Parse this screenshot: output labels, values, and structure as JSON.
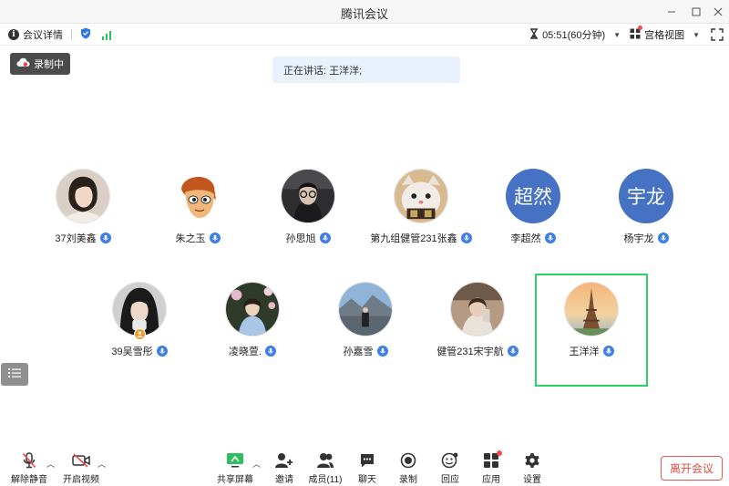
{
  "window": {
    "title": "腾讯会议"
  },
  "infobar": {
    "meeting_details": "会议详情",
    "timer": "05:51(60分钟)",
    "view_mode": "宫格视图"
  },
  "recording_badge": "录制中",
  "speaking_label": "正在讲话: 王洋洋;",
  "participants": [
    {
      "name": "37刘美鑫",
      "avatar": "photo-woman"
    },
    {
      "name": "朱之玉",
      "avatar": "cartoon-boy"
    },
    {
      "name": "孙思旭",
      "avatar": "photo-man-glasses"
    },
    {
      "name": "第九组健管231张鑫",
      "avatar": "photo-cat"
    },
    {
      "name": "李超然",
      "avatar_text": "超然"
    },
    {
      "name": "杨宇龙",
      "avatar_text": "宇龙"
    },
    {
      "name": "39吴雪彤",
      "avatar": "photo-girl"
    },
    {
      "name": "凌晓萱.",
      "avatar": "photo-flowers"
    },
    {
      "name": "孙嘉雪",
      "avatar": "photo-scenery"
    },
    {
      "name": "健管231宋宇航",
      "avatar": "photo-selfie"
    },
    {
      "name": "王洋洋",
      "avatar": "photo-eiffel-tower"
    }
  ],
  "toolbar": {
    "unmute": "解除静音",
    "start_video": "开启视频",
    "share_screen": "共享屏幕",
    "invite": "邀请",
    "members": "成员(11)",
    "chat": "聊天",
    "record": "录制",
    "reaction": "回应",
    "apps": "应用",
    "settings": "设置",
    "leave": "离开会议"
  },
  "colors": {
    "accent_blue": "#3d7ee8",
    "active_speaker_border": "#2fcf6a",
    "leave_red": "#e24b3f",
    "text_avatar_bg": "#4672c4"
  }
}
